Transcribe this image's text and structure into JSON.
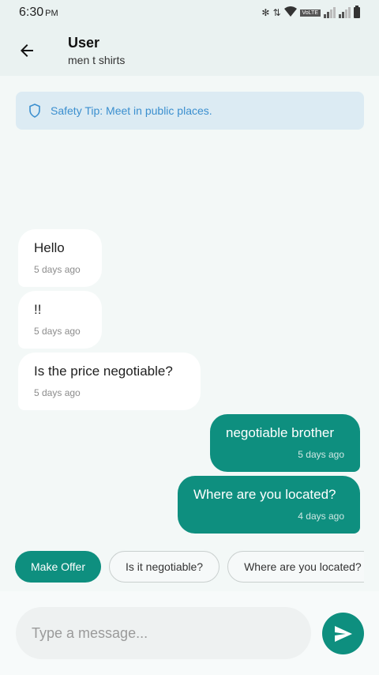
{
  "status_bar": {
    "time": "6:30",
    "ampm": "PM",
    "volte": "VoLTE"
  },
  "header": {
    "title": "User",
    "subtitle": "men t shirts"
  },
  "safety_tip": "Safety Tip: Meet in public places.",
  "messages": [
    {
      "direction": "in",
      "text": "Hello",
      "time": "5 days ago"
    },
    {
      "direction": "in",
      "text": "!!",
      "time": "5 days ago"
    },
    {
      "direction": "in",
      "text": "Is the price negotiable?",
      "time": "5 days ago"
    },
    {
      "direction": "out",
      "text": "negotiable brother",
      "time": "5 days ago"
    },
    {
      "direction": "out",
      "text": "Where are you located?",
      "time": "4 days ago"
    }
  ],
  "quick_replies": [
    "Make Offer",
    "Is it negotiable?",
    "Where are you located?"
  ],
  "composer": {
    "placeholder": "Type a message..."
  },
  "colors": {
    "accent": "#0e8f7f",
    "tip_bg": "#dcebf3",
    "tip_text": "#3b8fcf"
  }
}
